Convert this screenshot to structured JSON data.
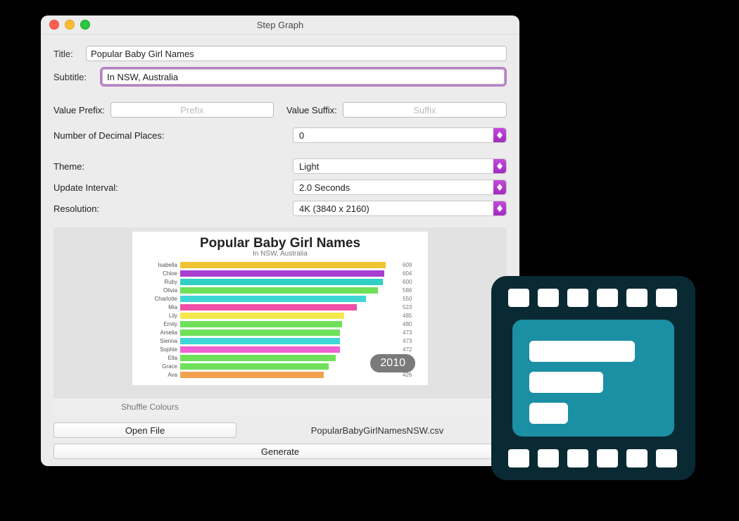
{
  "window": {
    "title": "Step Graph"
  },
  "labels": {
    "title": "Title:",
    "subtitle": "Subtitle:",
    "valuePrefix": "Value Prefix:",
    "valueSuffix": "Value Suffix:",
    "decimalPlaces": "Number of Decimal Places:",
    "theme": "Theme:",
    "updateInterval": "Update Interval:",
    "resolution": "Resolution:",
    "shuffleColours": "Shuffle Colours",
    "openFile": "Open File",
    "generate": "Generate"
  },
  "fields": {
    "title": "Popular Baby Girl Names",
    "subtitle": "In NSW, Australia",
    "valuePrefixPlaceholder": "Prefix",
    "valueSuffixPlaceholder": "Suffix",
    "decimalPlaces": "0",
    "theme": "Light",
    "updateInterval": "2.0 Seconds",
    "resolution": "4K (3840 x 2160)"
  },
  "filename": "PopularBabyGirlNamesNSW.csv",
  "chart_data": {
    "type": "bar",
    "title": "Popular Baby Girl Names",
    "subtitle": "In NSW, Australia",
    "xlabel": "",
    "ylabel": "",
    "xlim": [
      0,
      650
    ],
    "year": "2010",
    "categories": [
      "Isabella",
      "Chloe",
      "Ruby",
      "Olivia",
      "Charlotte",
      "Mia",
      "Lily",
      "Emily",
      "Amelia",
      "Sienna",
      "Sophie",
      "Ella",
      "Grace",
      "Ava"
    ],
    "values": [
      609,
      604,
      600,
      586,
      550,
      523,
      485,
      480,
      473,
      473,
      472,
      461,
      440,
      426
    ],
    "colors": [
      "#f0c330",
      "#a83fd1",
      "#30d0c6",
      "#6fe05a",
      "#3fd6d6",
      "#ef4fa6",
      "#f5e84f",
      "#6fe05a",
      "#6fe05a",
      "#3fd6d6",
      "#f261d2",
      "#6fe05a",
      "#6fe05a",
      "#f2a24f"
    ]
  }
}
